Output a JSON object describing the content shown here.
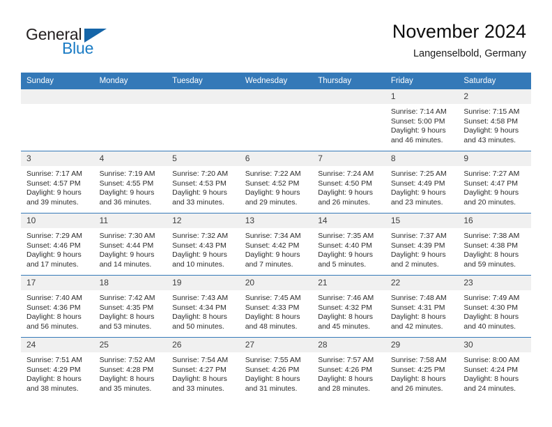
{
  "logo": {
    "word_top": "General",
    "word_bottom": "Blue",
    "triangle_color": "#1565a8",
    "blue_color": "#1a7bc4"
  },
  "header": {
    "title": "November 2024",
    "subtitle": "Langenselbold, Germany"
  },
  "theme": {
    "header_blue": "#3479b8",
    "daynum_band": "#f0f0f0"
  },
  "weekdays": [
    "Sunday",
    "Monday",
    "Tuesday",
    "Wednesday",
    "Thursday",
    "Friday",
    "Saturday"
  ],
  "labels": {
    "sunrise_prefix": "Sunrise:",
    "sunset_prefix": "Sunset:",
    "daylight_prefix": "Daylight:"
  },
  "weeks": [
    [
      {
        "day": "",
        "empty": true
      },
      {
        "day": "",
        "empty": true
      },
      {
        "day": "",
        "empty": true
      },
      {
        "day": "",
        "empty": true
      },
      {
        "day": "",
        "empty": true
      },
      {
        "day": "1",
        "sunrise": "Sunrise: 7:14 AM",
        "sunset": "Sunset: 5:00 PM",
        "daylight": "Daylight: 9 hours and 46 minutes."
      },
      {
        "day": "2",
        "sunrise": "Sunrise: 7:15 AM",
        "sunset": "Sunset: 4:58 PM",
        "daylight": "Daylight: 9 hours and 43 minutes."
      }
    ],
    [
      {
        "day": "3",
        "sunrise": "Sunrise: 7:17 AM",
        "sunset": "Sunset: 4:57 PM",
        "daylight": "Daylight: 9 hours and 39 minutes."
      },
      {
        "day": "4",
        "sunrise": "Sunrise: 7:19 AM",
        "sunset": "Sunset: 4:55 PM",
        "daylight": "Daylight: 9 hours and 36 minutes."
      },
      {
        "day": "5",
        "sunrise": "Sunrise: 7:20 AM",
        "sunset": "Sunset: 4:53 PM",
        "daylight": "Daylight: 9 hours and 33 minutes."
      },
      {
        "day": "6",
        "sunrise": "Sunrise: 7:22 AM",
        "sunset": "Sunset: 4:52 PM",
        "daylight": "Daylight: 9 hours and 29 minutes."
      },
      {
        "day": "7",
        "sunrise": "Sunrise: 7:24 AM",
        "sunset": "Sunset: 4:50 PM",
        "daylight": "Daylight: 9 hours and 26 minutes."
      },
      {
        "day": "8",
        "sunrise": "Sunrise: 7:25 AM",
        "sunset": "Sunset: 4:49 PM",
        "daylight": "Daylight: 9 hours and 23 minutes."
      },
      {
        "day": "9",
        "sunrise": "Sunrise: 7:27 AM",
        "sunset": "Sunset: 4:47 PM",
        "daylight": "Daylight: 9 hours and 20 minutes."
      }
    ],
    [
      {
        "day": "10",
        "sunrise": "Sunrise: 7:29 AM",
        "sunset": "Sunset: 4:46 PM",
        "daylight": "Daylight: 9 hours and 17 minutes."
      },
      {
        "day": "11",
        "sunrise": "Sunrise: 7:30 AM",
        "sunset": "Sunset: 4:44 PM",
        "daylight": "Daylight: 9 hours and 14 minutes."
      },
      {
        "day": "12",
        "sunrise": "Sunrise: 7:32 AM",
        "sunset": "Sunset: 4:43 PM",
        "daylight": "Daylight: 9 hours and 10 minutes."
      },
      {
        "day": "13",
        "sunrise": "Sunrise: 7:34 AM",
        "sunset": "Sunset: 4:42 PM",
        "daylight": "Daylight: 9 hours and 7 minutes."
      },
      {
        "day": "14",
        "sunrise": "Sunrise: 7:35 AM",
        "sunset": "Sunset: 4:40 PM",
        "daylight": "Daylight: 9 hours and 5 minutes."
      },
      {
        "day": "15",
        "sunrise": "Sunrise: 7:37 AM",
        "sunset": "Sunset: 4:39 PM",
        "daylight": "Daylight: 9 hours and 2 minutes."
      },
      {
        "day": "16",
        "sunrise": "Sunrise: 7:38 AM",
        "sunset": "Sunset: 4:38 PM",
        "daylight": "Daylight: 8 hours and 59 minutes."
      }
    ],
    [
      {
        "day": "17",
        "sunrise": "Sunrise: 7:40 AM",
        "sunset": "Sunset: 4:36 PM",
        "daylight": "Daylight: 8 hours and 56 minutes."
      },
      {
        "day": "18",
        "sunrise": "Sunrise: 7:42 AM",
        "sunset": "Sunset: 4:35 PM",
        "daylight": "Daylight: 8 hours and 53 minutes."
      },
      {
        "day": "19",
        "sunrise": "Sunrise: 7:43 AM",
        "sunset": "Sunset: 4:34 PM",
        "daylight": "Daylight: 8 hours and 50 minutes."
      },
      {
        "day": "20",
        "sunrise": "Sunrise: 7:45 AM",
        "sunset": "Sunset: 4:33 PM",
        "daylight": "Daylight: 8 hours and 48 minutes."
      },
      {
        "day": "21",
        "sunrise": "Sunrise: 7:46 AM",
        "sunset": "Sunset: 4:32 PM",
        "daylight": "Daylight: 8 hours and 45 minutes."
      },
      {
        "day": "22",
        "sunrise": "Sunrise: 7:48 AM",
        "sunset": "Sunset: 4:31 PM",
        "daylight": "Daylight: 8 hours and 42 minutes."
      },
      {
        "day": "23",
        "sunrise": "Sunrise: 7:49 AM",
        "sunset": "Sunset: 4:30 PM",
        "daylight": "Daylight: 8 hours and 40 minutes."
      }
    ],
    [
      {
        "day": "24",
        "sunrise": "Sunrise: 7:51 AM",
        "sunset": "Sunset: 4:29 PM",
        "daylight": "Daylight: 8 hours and 38 minutes."
      },
      {
        "day": "25",
        "sunrise": "Sunrise: 7:52 AM",
        "sunset": "Sunset: 4:28 PM",
        "daylight": "Daylight: 8 hours and 35 minutes."
      },
      {
        "day": "26",
        "sunrise": "Sunrise: 7:54 AM",
        "sunset": "Sunset: 4:27 PM",
        "daylight": "Daylight: 8 hours and 33 minutes."
      },
      {
        "day": "27",
        "sunrise": "Sunrise: 7:55 AM",
        "sunset": "Sunset: 4:26 PM",
        "daylight": "Daylight: 8 hours and 31 minutes."
      },
      {
        "day": "28",
        "sunrise": "Sunrise: 7:57 AM",
        "sunset": "Sunset: 4:26 PM",
        "daylight": "Daylight: 8 hours and 28 minutes."
      },
      {
        "day": "29",
        "sunrise": "Sunrise: 7:58 AM",
        "sunset": "Sunset: 4:25 PM",
        "daylight": "Daylight: 8 hours and 26 minutes."
      },
      {
        "day": "30",
        "sunrise": "Sunrise: 8:00 AM",
        "sunset": "Sunset: 4:24 PM",
        "daylight": "Daylight: 8 hours and 24 minutes."
      }
    ]
  ]
}
